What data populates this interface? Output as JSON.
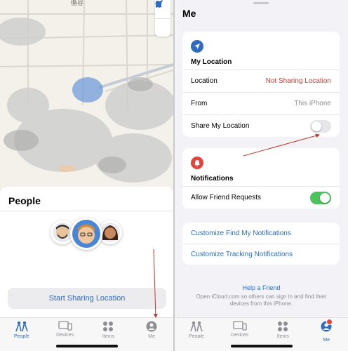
{
  "map": {
    "label": "循谷"
  },
  "people": {
    "title": "People",
    "start_sharing_label": "Start Sharing Location"
  },
  "tabs": [
    {
      "label": "People"
    },
    {
      "label": "Devices"
    },
    {
      "label": "Items"
    },
    {
      "label": "Me"
    }
  ],
  "me": {
    "title": "Me",
    "my_location": {
      "heading": "My Location",
      "rows": [
        {
          "label": "Location",
          "value": "Not Sharing Location"
        },
        {
          "label": "From",
          "value": "This iPhone"
        },
        {
          "label": "Share My Location",
          "toggle": "off"
        }
      ]
    },
    "notifications": {
      "heading": "Notifications",
      "rows": [
        {
          "label": "Allow Friend Requests",
          "toggle": "on"
        }
      ]
    },
    "links": [
      {
        "label": "Customize Find My Notifications"
      },
      {
        "label": "Customize Tracking Notifications"
      }
    ],
    "help": {
      "link": "Help a Friend",
      "description": "Open iCloud.com so others can sign in and find their devices from this iPhone."
    }
  },
  "colors": {
    "accent": "#2f6bc0",
    "red": "#d93a2c",
    "toggle_on": "#4cc35c",
    "badge": "#e5433a"
  }
}
